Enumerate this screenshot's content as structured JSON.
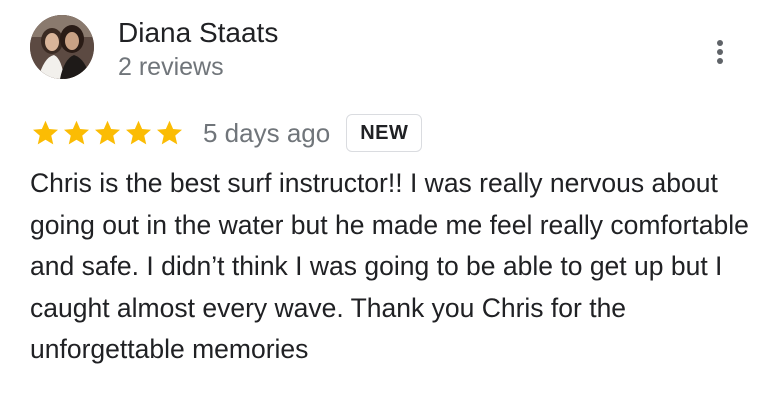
{
  "review": {
    "author": {
      "name": "Diana Staats",
      "review_count": "2 reviews",
      "avatar_icon": "profile-photo"
    },
    "rating": {
      "stars": 5,
      "out_of": 5,
      "star_color": "#fbbc04"
    },
    "date": "5 days ago",
    "badge": "NEW",
    "text": "Chris is the best surf instructor!! I was really nervous about going out in the water but he made me feel really comfortable and safe. I didn’t think I was going to be able to get up but I caught almost every wave. Thank you Chris for the unforgettable memories",
    "more_options_icon": "more-vert-icon"
  }
}
